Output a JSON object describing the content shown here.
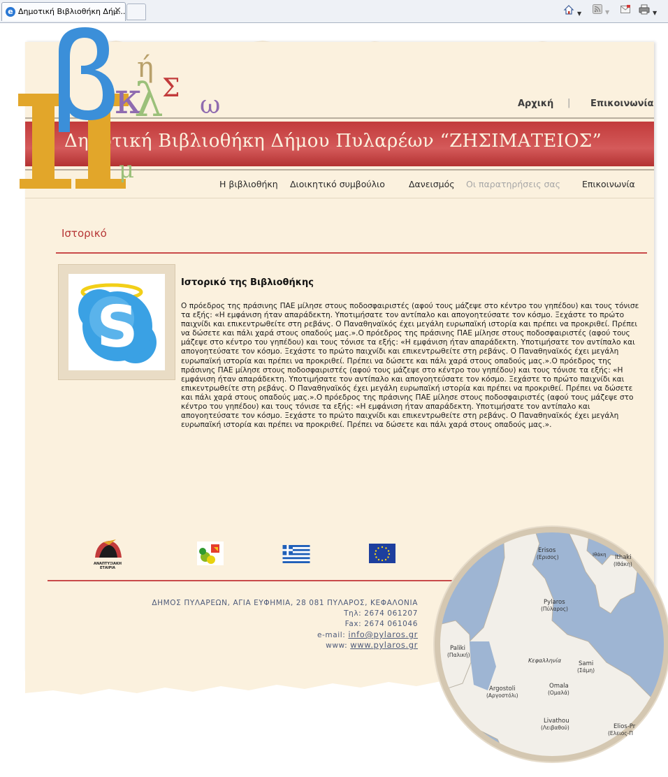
{
  "browser": {
    "tab_title": "Δημοτική Βιβλιοθήκη Δήμ...",
    "toolbar_icons": [
      "home-icon",
      "feeds-icon",
      "read-mail-icon",
      "print-icon"
    ]
  },
  "header": {
    "banner_title": "Δημοτική Βιβλιοθήκη Δήμου Πυλαρέων “ΖΗΣΙΜΑΤΕΙΟΣ”",
    "top_links": [
      "Αρχική",
      "Επικοινωνία"
    ],
    "top_separator": "|",
    "logo_letters": {
      "beta": "β",
      "pi": "Π",
      "eta": "ή",
      "kappa": "κ",
      "alpha": "λ",
      "sigma": "Σ",
      "omega": "ω",
      "mu": "μ"
    }
  },
  "nav": {
    "items": [
      {
        "label": "Η βιβλιοθήκη",
        "active": true
      },
      {
        "label": "Διοικητικό συμβούλιο",
        "active": true
      },
      {
        "label": "Δανεισμός",
        "active": true
      },
      {
        "label": "Οι παρατηρήσεις σας",
        "active": false
      },
      {
        "label": "Επικοινωνία",
        "active": true
      }
    ]
  },
  "main": {
    "section_title": "Ιστορικό",
    "article_title": "Ιστορικό της Βιβλιοθήκης",
    "article_body": "Ο πρόεδρος της πράσινης ΠΑΕ μίλησε στους ποδοσφαιριστές (αφού τους μάζεψε στο κέντρο του γηπέδου) και τους τόνισε τα εξής: «Η εμφάνιση ήταν απαράδεκτη. Υποτιμήσατε τον αντίπαλο και απογοητεύσατε τον κόσμο. Ξεχάστε το πρώτο παιχνίδι και επικεντρωθείτε στη ρεβάνς. Ο Παναθηναϊκός έχει μεγάλη ευρωπαϊκή ιστορία και πρέπει να προκριθεί. Πρέπει να δώσετε και πάλι χαρά στους οπαδούς μας.».Ο πρόεδρος της πράσινης ΠΑΕ μίλησε στους ποδοσφαιριστές (αφού τους μάζεψε στο κέντρο του γηπέδου) και τους τόνισε τα εξής: «Η εμφάνιση ήταν απαράδεκτη. Υποτιμήσατε τον αντίπαλο και απογοητεύσατε τον κόσμο. Ξεχάστε το πρώτο παιχνίδι και επικεντρωθείτε στη ρεβάνς. Ο Παναθηναϊκός έχει μεγάλη ευρωπαϊκή ιστορία και πρέπει να προκριθεί. Πρέπει να δώσετε και πάλι χαρά στους οπαδούς μας.».Ο πρόεδρος της πράσινης ΠΑΕ μίλησε στους ποδοσφαιριστές (αφού τους μάζεψε στο κέντρο του γηπέδου) και τους τόνισε τα εξής: «Η εμφάνιση ήταν απαράδεκτη. Υποτιμήσατε τον αντίπαλο και απογοητεύσατε τον κόσμο. Ξεχάστε το πρώτο παιχνίδι και επικεντρωθείτε στη ρεβάνς. Ο Παναθηναϊκός έχει μεγάλη ευρωπαϊκή ιστορία και πρέπει να προκριθεί. Πρέπει να δώσετε και πάλι χαρά στους οπαδούς μας.».Ο πρόεδρος της πράσινης ΠΑΕ μίλησε στους ποδοσφαιριστές (αφού τους μάζεψε στο κέντρο του γηπέδου) και τους τόνισε τα εξής: «Η εμφάνιση ήταν απαράδεκτη. Υποτιμήσατε τον αντίπαλο και απογοητεύσατε τον κόσμο. Ξεχάστε το πρώτο παιχνίδι και επικεντρωθείτε στη ρεβάνς. Ο Παναθηναϊκός έχει μεγάλη ευρωπαϊκή ιστορία και πρέπει να προκριθεί. Πρέπει να δώσετε και πάλι χαρά στους οπαδούς μας.»."
  },
  "partner_logos": [
    {
      "name": "anaptyxiaki-etaireia-logo",
      "caption": "ΑΝΑΠΤΥΞΙΑΚΗ ΕΤΑΙΡΙΑ"
    },
    {
      "name": "program-logo"
    },
    {
      "name": "greek-flag"
    },
    {
      "name": "eu-flag"
    }
  ],
  "footer": {
    "address": "ΔΗΜΟΣ ΠΥΛΑΡΕΩΝ, ΑΓΙΑ ΕΥΦΗΜΙΑ, 28 081 ΠΥΛΑΡΟΣ, ΚΕΦΑΛΟΝΙΑ",
    "phone": "Τηλ: 2674 061207",
    "fax": "Fax: 2674 061046",
    "email_label": "e-mail:",
    "email": "info@pylaros.gr",
    "www_label": "www:",
    "www": "www.pylaros.gr"
  },
  "map": {
    "labels": [
      {
        "name": "Erisos",
        "sub": "(Ερισος)"
      },
      {
        "name": "Ithaki",
        "sub": "(Ιθάκη)"
      },
      {
        "name": "Ιθάκη",
        "sub": ""
      },
      {
        "name": "Pylaros",
        "sub": "(Πύλαρος)"
      },
      {
        "name": "Paliki",
        "sub": "(Παλική)"
      },
      {
        "name": "Κεφαλληνία",
        "sub": ""
      },
      {
        "name": "Sami",
        "sub": "(Σάμη)"
      },
      {
        "name": "Argostoli",
        "sub": "(Αργοστόλι)"
      },
      {
        "name": "Omala",
        "sub": "(Ομαλά)"
      },
      {
        "name": "Livathou",
        "sub": "(Λειβαθού)"
      },
      {
        "name": "Elios-Pr",
        "sub": "(Ελειος-Π"
      }
    ]
  },
  "colors": {
    "paper": "#fbf1de",
    "banner_red": "#c94040",
    "accent_red": "#b63636",
    "footer_text": "#4d5a7a",
    "logo_blue": "#3b8fd9",
    "logo_gold": "#e2a62a",
    "logo_purple": "#8f6bb0",
    "logo_green": "#9bc07a"
  }
}
